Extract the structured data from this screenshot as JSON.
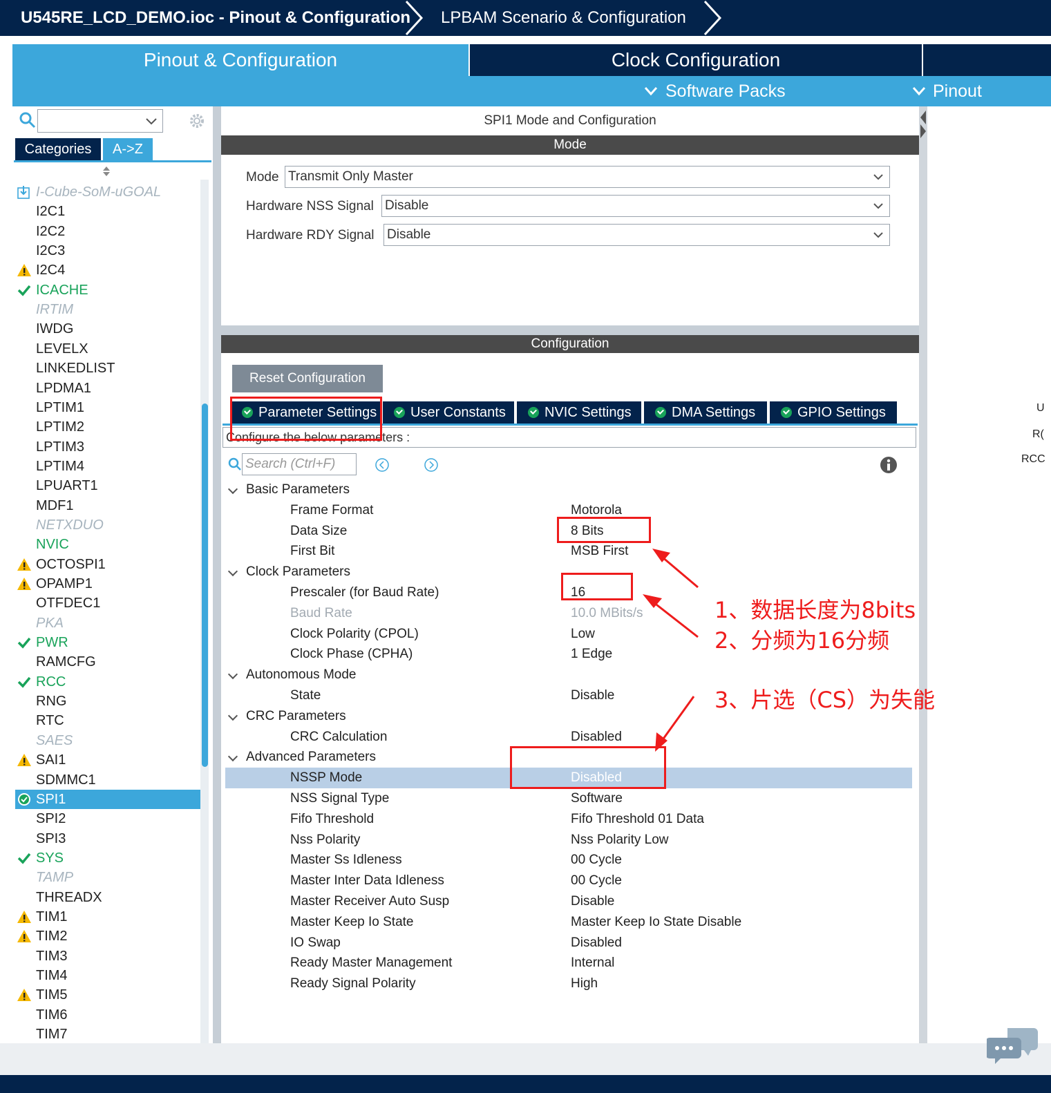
{
  "breadcrumb": {
    "project": "U545RE_LCD_DEMO.ioc - Pinout & Configuration",
    "lpbam": "LPBAM Scenario & Configuration"
  },
  "main_tabs": [
    {
      "label": "Pinout & Configuration",
      "active": true
    },
    {
      "label": "Clock Configuration",
      "active": false
    }
  ],
  "sub_menu": {
    "software_packs": "Software Packs",
    "pinout": "Pinout"
  },
  "left_panel": {
    "search_value": "",
    "tabs": [
      "Categories",
      "A->Z"
    ],
    "items": [
      {
        "label": "I-Cube-SoM-uGOAL",
        "state": "grey",
        "icon": "download-icon"
      },
      {
        "label": "I2C1",
        "state": "normal",
        "icon": ""
      },
      {
        "label": "I2C2",
        "state": "normal",
        "icon": ""
      },
      {
        "label": "I2C3",
        "state": "normal",
        "icon": ""
      },
      {
        "label": "I2C4",
        "state": "normal",
        "icon": "warning-icon"
      },
      {
        "label": "ICACHE",
        "state": "green",
        "icon": "check-icon"
      },
      {
        "label": "IRTIM",
        "state": "grey",
        "icon": ""
      },
      {
        "label": "IWDG",
        "state": "normal",
        "icon": ""
      },
      {
        "label": "LEVELX",
        "state": "normal",
        "icon": ""
      },
      {
        "label": "LINKEDLIST",
        "state": "normal",
        "icon": ""
      },
      {
        "label": "LPDMA1",
        "state": "normal",
        "icon": ""
      },
      {
        "label": "LPTIM1",
        "state": "normal",
        "icon": ""
      },
      {
        "label": "LPTIM2",
        "state": "normal",
        "icon": ""
      },
      {
        "label": "LPTIM3",
        "state": "normal",
        "icon": ""
      },
      {
        "label": "LPTIM4",
        "state": "normal",
        "icon": ""
      },
      {
        "label": "LPUART1",
        "state": "normal",
        "icon": ""
      },
      {
        "label": "MDF1",
        "state": "normal",
        "icon": ""
      },
      {
        "label": "NETXDUO",
        "state": "grey",
        "icon": ""
      },
      {
        "label": "NVIC",
        "state": "green",
        "icon": ""
      },
      {
        "label": "OCTOSPI1",
        "state": "normal",
        "icon": "warning-icon"
      },
      {
        "label": "OPAMP1",
        "state": "normal",
        "icon": "warning-icon"
      },
      {
        "label": "OTFDEC1",
        "state": "normal",
        "icon": ""
      },
      {
        "label": "PKA",
        "state": "grey",
        "icon": ""
      },
      {
        "label": "PWR",
        "state": "green",
        "icon": "check-icon"
      },
      {
        "label": "RAMCFG",
        "state": "normal",
        "icon": ""
      },
      {
        "label": "RCC",
        "state": "green",
        "icon": "check-icon"
      },
      {
        "label": "RNG",
        "state": "normal",
        "icon": ""
      },
      {
        "label": "RTC",
        "state": "normal",
        "icon": ""
      },
      {
        "label": "SAES",
        "state": "grey",
        "icon": ""
      },
      {
        "label": "SAI1",
        "state": "normal",
        "icon": "warning-icon"
      },
      {
        "label": "SDMMC1",
        "state": "normal",
        "icon": ""
      },
      {
        "label": "SPI1",
        "state": "selected",
        "icon": "check-circle-icon"
      },
      {
        "label": "SPI2",
        "state": "normal",
        "icon": ""
      },
      {
        "label": "SPI3",
        "state": "normal",
        "icon": ""
      },
      {
        "label": "SYS",
        "state": "green",
        "icon": "check-icon"
      },
      {
        "label": "TAMP",
        "state": "grey",
        "icon": ""
      },
      {
        "label": "THREADX",
        "state": "normal",
        "icon": ""
      },
      {
        "label": "TIM1",
        "state": "normal",
        "icon": "warning-icon"
      },
      {
        "label": "TIM2",
        "state": "normal",
        "icon": "warning-icon"
      },
      {
        "label": "TIM3",
        "state": "normal",
        "icon": ""
      },
      {
        "label": "TIM4",
        "state": "normal",
        "icon": ""
      },
      {
        "label": "TIM5",
        "state": "normal",
        "icon": "warning-icon"
      },
      {
        "label": "TIM6",
        "state": "normal",
        "icon": ""
      },
      {
        "label": "TIM7",
        "state": "normal",
        "icon": ""
      }
    ]
  },
  "center": {
    "title": "SPI1 Mode and Configuration",
    "mode_header": "Mode",
    "mode_fields": [
      {
        "label": "Mode",
        "value": "Transmit Only Master"
      },
      {
        "label": "Hardware NSS Signal",
        "value": "Disable"
      },
      {
        "label": "Hardware RDY Signal",
        "value": "Disable"
      }
    ],
    "config_header": "Configuration",
    "reset_button": "Reset Configuration",
    "config_tabs": [
      "Parameter Settings",
      "User Constants",
      "NVIC Settings",
      "DMA Settings",
      "GPIO Settings"
    ],
    "configure_note": "Configure the below parameters :",
    "search_placeholder": "Search (Ctrl+F)",
    "params": [
      {
        "type": "group",
        "name": "Basic Parameters"
      },
      {
        "type": "param",
        "name": "Frame Format",
        "value": "Motorola"
      },
      {
        "type": "param",
        "name": "Data Size",
        "value": "8 Bits"
      },
      {
        "type": "param",
        "name": "First Bit",
        "value": "MSB First"
      },
      {
        "type": "group",
        "name": "Clock Parameters"
      },
      {
        "type": "param",
        "name": "Prescaler (for Baud Rate)",
        "value": "16"
      },
      {
        "type": "param",
        "name": "Baud Rate",
        "value": "10.0 MBits/s",
        "dim": true
      },
      {
        "type": "param",
        "name": "Clock Polarity (CPOL)",
        "value": "Low"
      },
      {
        "type": "param",
        "name": "Clock Phase (CPHA)",
        "value": "1 Edge"
      },
      {
        "type": "group",
        "name": "Autonomous Mode"
      },
      {
        "type": "param",
        "name": "State",
        "value": "Disable"
      },
      {
        "type": "group",
        "name": "CRC Parameters"
      },
      {
        "type": "param",
        "name": "CRC Calculation",
        "value": "Disabled"
      },
      {
        "type": "group",
        "name": "Advanced Parameters"
      },
      {
        "type": "param",
        "name": "NSSP Mode",
        "value": "Disabled",
        "selected": true
      },
      {
        "type": "param",
        "name": "NSS Signal Type",
        "value": "Software"
      },
      {
        "type": "param",
        "name": "Fifo Threshold",
        "value": "Fifo Threshold 01 Data"
      },
      {
        "type": "param",
        "name": "Nss Polarity",
        "value": "Nss Polarity Low"
      },
      {
        "type": "param",
        "name": "Master Ss Idleness",
        "value": "00 Cycle"
      },
      {
        "type": "param",
        "name": "Master Inter Data Idleness",
        "value": "00 Cycle"
      },
      {
        "type": "param",
        "name": "Master Receiver Auto Susp",
        "value": "Disable"
      },
      {
        "type": "param",
        "name": "Master Keep Io State",
        "value": "Master Keep Io State Disable"
      },
      {
        "type": "param",
        "name": "IO Swap",
        "value": "Disabled"
      },
      {
        "type": "param",
        "name": "Ready Master Management",
        "value": "Internal"
      },
      {
        "type": "param",
        "name": "Ready Signal Polarity",
        "value": "High"
      }
    ]
  },
  "right_edge_texts": [
    "U",
    "R(",
    "RCC"
  ],
  "annotations": [
    "1、数据长度为8bits",
    "2、分频为16分频",
    "3、片选（CS）为失能"
  ],
  "colors": {
    "navy": "#03234b",
    "accent_blue": "#3ca7db",
    "green": "#19a35a",
    "warning": "#f5b800",
    "annotation_red": "#ee1c1c"
  }
}
